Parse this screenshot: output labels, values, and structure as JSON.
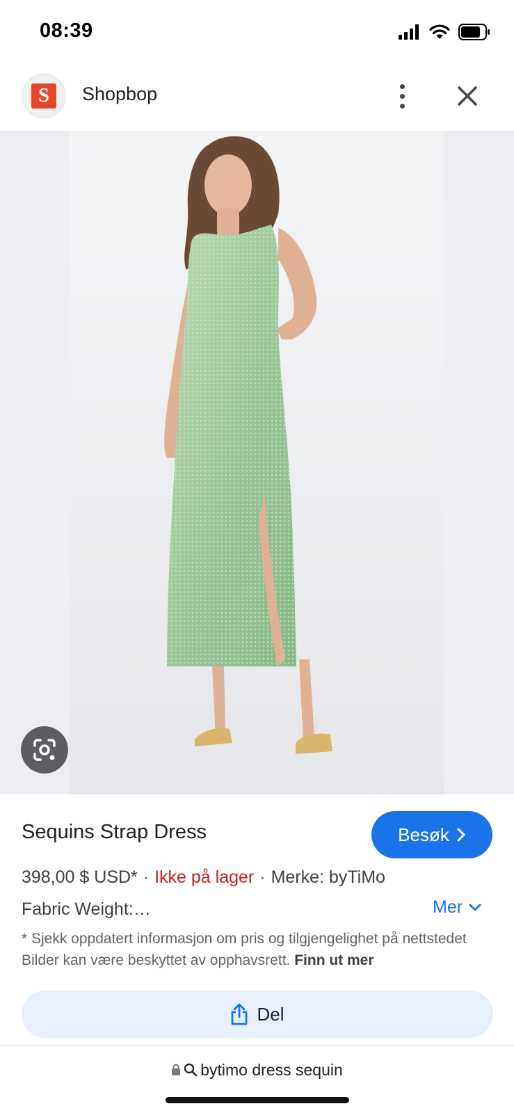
{
  "status_bar": {
    "time": "08:39"
  },
  "header": {
    "site_name": "Shopbop",
    "logo_letter": "S"
  },
  "product": {
    "title": "Sequins Strap Dress",
    "price": "398,00 $ USD*",
    "stock_status": "Ikke på lager",
    "brand": "Merke: byTiMo",
    "fabric": "Fabric Weight:…",
    "separator": "·"
  },
  "actions": {
    "visit_label": "Besøk",
    "more_label": "Mer",
    "share_label": "Del"
  },
  "disclaimer": {
    "text": "* Sjekk oppdatert informasjon om pris og tilgjengelighet på nettstedet Bilder kan være beskyttet av opphavsrett.",
    "link": "Finn ut mer"
  },
  "url_bar": {
    "query": "bytimo dress sequin"
  },
  "colors": {
    "accent": "#1a73e8",
    "stock_red": "#c5221f",
    "share_bg": "#e8f0fe",
    "logo": "#e4472a",
    "dress": "#9cc79a"
  },
  "icons": [
    "signal-icon",
    "wifi-icon",
    "battery-icon",
    "more-vert-icon",
    "close-icon",
    "lens-icon",
    "chevron-right-icon",
    "chevron-down-icon",
    "share-icon",
    "lock-icon",
    "search-icon"
  ]
}
